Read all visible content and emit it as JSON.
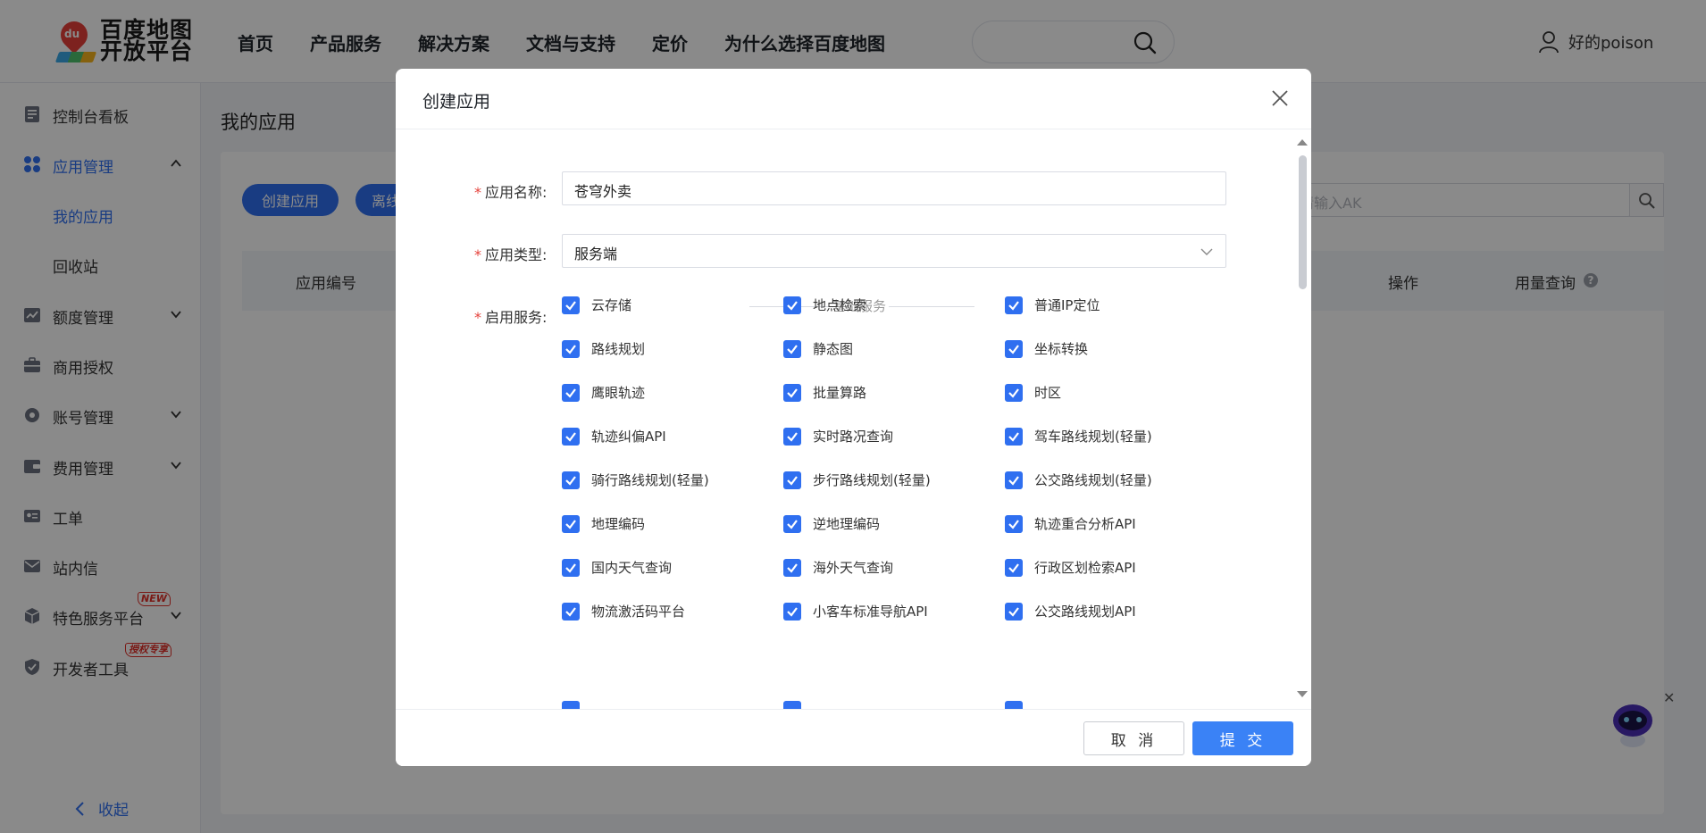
{
  "header": {
    "logo_line1": "百度地图",
    "logo_line2": "开放平台",
    "logo_pin_text": "du",
    "nav": [
      "首页",
      "产品服务",
      "解决方案",
      "文档与支持",
      "定价",
      "为什么选择百度地图"
    ],
    "username": "好的poison"
  },
  "sidebar": {
    "items": [
      {
        "label": "控制台看板",
        "icon": "dashboard-icon"
      },
      {
        "label": "应用管理",
        "icon": "apps-icon"
      },
      {
        "label": "我的应用"
      },
      {
        "label": "回收站"
      },
      {
        "label": "额度管理",
        "icon": "chart-icon"
      },
      {
        "label": "商用授权",
        "icon": "briefcase-icon"
      },
      {
        "label": "账号管理",
        "icon": "gear-icon"
      },
      {
        "label": "费用管理",
        "icon": "wallet-icon"
      },
      {
        "label": "工单",
        "icon": "ticket-icon"
      },
      {
        "label": "站内信",
        "icon": "mail-icon"
      },
      {
        "label": "特色服务平台",
        "icon": "cube-icon",
        "badge": "NEW"
      },
      {
        "label": "开发者工具",
        "icon": "shield-icon",
        "badge": "授权专享"
      }
    ],
    "collapse_label": "收起"
  },
  "main": {
    "title": "我的应用",
    "create_button": "创建应用",
    "offline_button": "离线",
    "ak_placeholder": "请输入AK",
    "table_headers": [
      "应用编号",
      "操作",
      "用量查询"
    ]
  },
  "modal": {
    "title": "创建应用",
    "app_name_label": "应用名称:",
    "app_name_value": "苍穹外卖",
    "app_type_label": "应用类型:",
    "app_type_value": "服务端",
    "services_label": "启用服务:",
    "section_title": "基础服务",
    "services": [
      [
        "云存储",
        "地点检索",
        "普通IP定位"
      ],
      [
        "路线规划",
        "静态图",
        "坐标转换"
      ],
      [
        "鹰眼轨迹",
        "批量算路",
        "时区"
      ],
      [
        "轨迹纠偏API",
        "实时路况查询",
        "驾车路线规划(轻量)"
      ],
      [
        "骑行路线规划(轻量)",
        "步行路线规划(轻量)",
        "公交路线规划(轻量)"
      ],
      [
        "地理编码",
        "逆地理编码",
        "轨迹重合分析API"
      ],
      [
        "国内天气查询",
        "海外天气查询",
        "行政区划检索API"
      ],
      [
        "物流激活码平台",
        "小客车标准导航API",
        "公交路线规划API"
      ]
    ],
    "cancel_button": "取 消",
    "submit_button": "提 交"
  },
  "colors": {
    "accent": "#2f6ff0",
    "submit": "#3a82f6",
    "required": "#e5413a",
    "overlay": "rgba(0,0,0,0.46)"
  }
}
